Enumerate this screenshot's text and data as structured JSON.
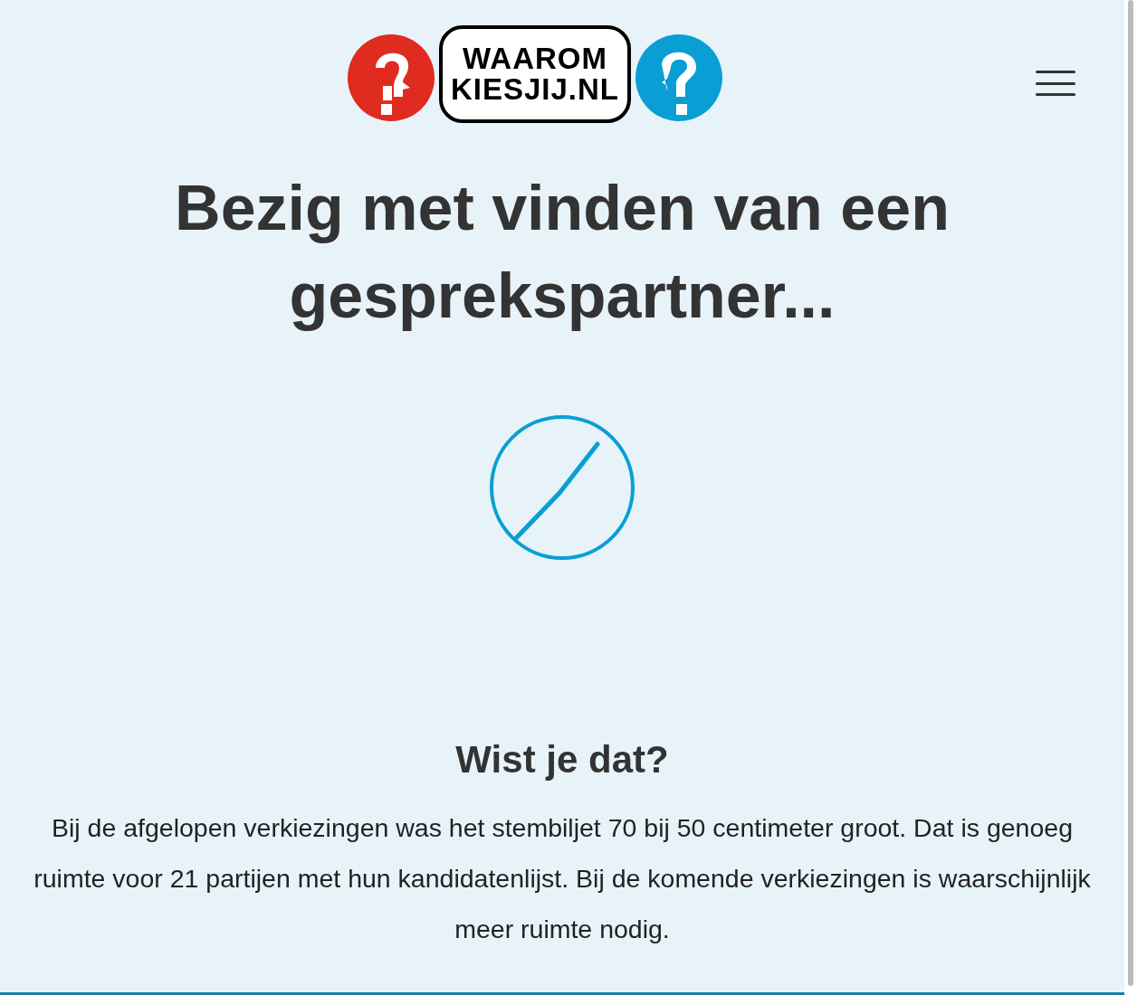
{
  "logo": {
    "line_1": "WAAROM",
    "line_2": "KIESJIJ.NL"
  },
  "heading": "Bezig met vinden van een gesprekspartner...",
  "fact": {
    "title": "Wist je dat?",
    "text": "Bij de afgelopen verkiezingen was het stembiljet 70 bij 50 centimeter groot. Dat is genoeg ruimte voor 21 partijen met hun kandidatenlijst. Bij de komende verkiezingen is waarschijnlijk meer ruimte nodig."
  }
}
